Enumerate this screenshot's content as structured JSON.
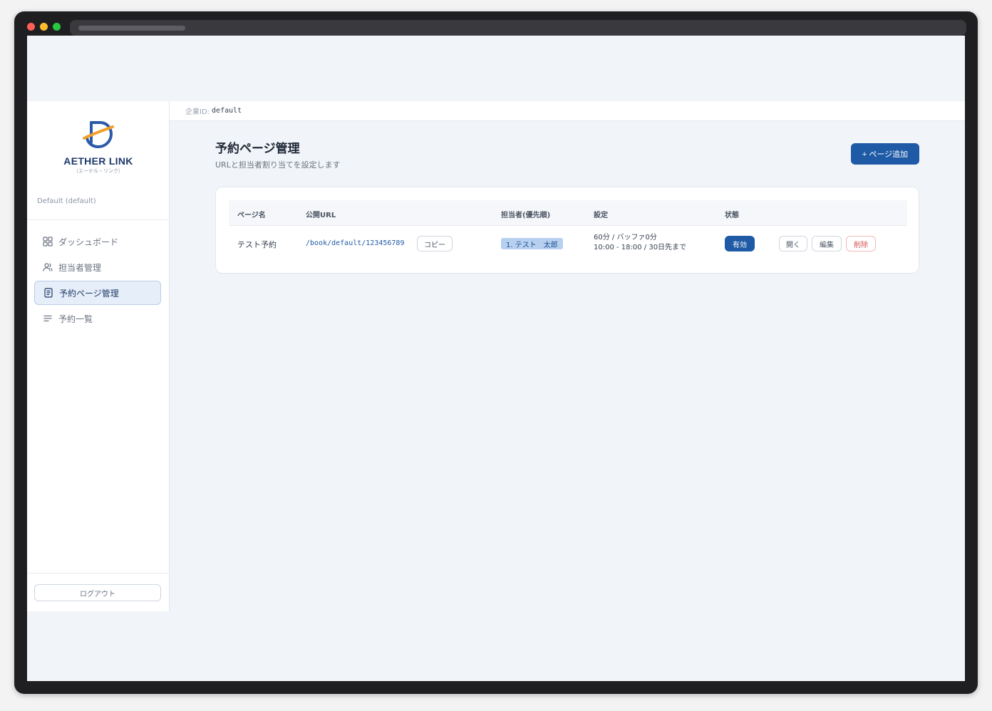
{
  "brand": {
    "name": "AETHER LINK",
    "subtitle": "（エーテル・リンク）"
  },
  "sidebar": {
    "tenant": "Default (default)",
    "items": [
      {
        "label": "ダッシュボード",
        "icon": "grid-icon",
        "active": false
      },
      {
        "label": "担当者管理",
        "icon": "users-icon",
        "active": false
      },
      {
        "label": "予約ページ管理",
        "icon": "document-icon",
        "active": true
      },
      {
        "label": "予約一覧",
        "icon": "list-icon",
        "active": false
      }
    ],
    "logout_label": "ログアウト"
  },
  "topbar": {
    "company_label": "企業ID:",
    "company_id": "default"
  },
  "page": {
    "title": "予約ページ管理",
    "subtitle": "URLと担当者割り当てを設定します",
    "add_button": "+ ページ追加"
  },
  "table": {
    "columns": [
      "ページ名",
      "公開URL",
      "担当者(優先順)",
      "設定",
      "状態"
    ],
    "rows": [
      {
        "name": "テスト予約",
        "url": "/book/default/123456789",
        "copy_label": "コピー",
        "assignee": "1. テスト　太郎",
        "settings_line1": "60分 / バッファ0分",
        "settings_line2": "10:00 - 18:00 / 30日先まで",
        "status": "有効",
        "open_label": "開く",
        "edit_label": "編集",
        "delete_label": "削除"
      }
    ]
  },
  "colors": {
    "primary": "#1f5aa6",
    "danger": "#d25353",
    "background": "#f1f4f8"
  }
}
